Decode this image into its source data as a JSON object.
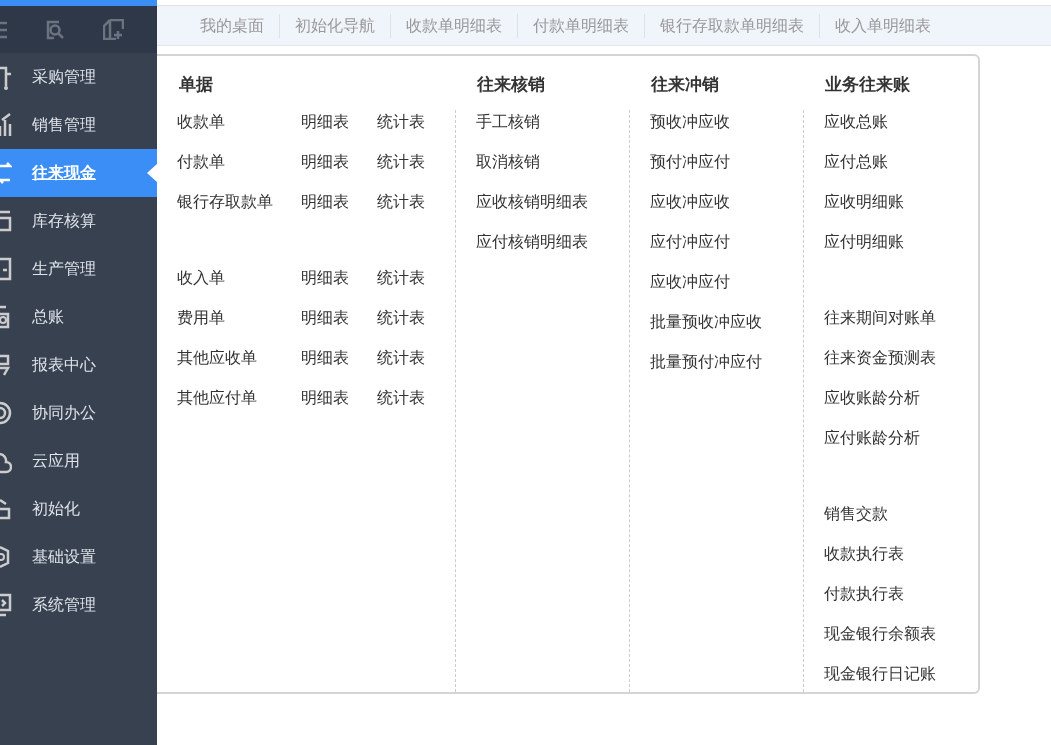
{
  "sidebar": {
    "items": [
      {
        "label": "采购管理",
        "selected": false
      },
      {
        "label": "销售管理",
        "selected": false
      },
      {
        "label": "往来现金",
        "selected": true
      },
      {
        "label": "库存核算",
        "selected": false
      },
      {
        "label": "生产管理",
        "selected": false
      },
      {
        "label": "总账",
        "selected": false
      },
      {
        "label": "报表中心",
        "selected": false
      },
      {
        "label": "协同办公",
        "selected": false
      },
      {
        "label": "云应用",
        "selected": false
      },
      {
        "label": "初始化",
        "selected": false
      },
      {
        "label": "基础设置",
        "selected": false
      },
      {
        "label": "系统管理",
        "selected": false
      }
    ]
  },
  "tabs": [
    "我的桌面",
    "初始化导航",
    "收款单明细表",
    "付款单明细表",
    "银行存取款单明细表",
    "收入单明细表"
  ],
  "menu": {
    "documents": {
      "heading": "单据",
      "groups": [
        [
          {
            "name": "收款单",
            "detail": "明细表",
            "stats": "统计表"
          },
          {
            "name": "付款单",
            "detail": "明细表",
            "stats": "统计表"
          },
          {
            "name": "银行存取款单",
            "detail": "明细表",
            "stats": "统计表"
          }
        ],
        [
          {
            "name": "收入单",
            "detail": "明细表",
            "stats": "统计表"
          },
          {
            "name": "费用单",
            "detail": "明细表",
            "stats": "统计表"
          },
          {
            "name": "其他应收单",
            "detail": "明细表",
            "stats": "统计表"
          },
          {
            "name": "其他应付单",
            "detail": "明细表",
            "stats": "统计表"
          }
        ]
      ]
    },
    "columns": [
      {
        "heading": "往来核销",
        "groups": [
          [
            "手工核销",
            "取消核销",
            "应收核销明细表",
            "应付核销明细表"
          ]
        ]
      },
      {
        "heading": "往来冲销",
        "groups": [
          [
            "预收冲应收",
            "预付冲应付",
            "应收冲应收",
            "应付冲应付",
            "应收冲应付",
            "批量预收冲应收",
            "批量预付冲应付"
          ]
        ]
      },
      {
        "heading": "业务往来账",
        "groups": [
          [
            "应收总账",
            "应付总账",
            "应收明细账",
            "应付明细账"
          ],
          [
            "往来期间对账单",
            "往来资金预测表",
            "应收账龄分析",
            "应付账龄分析"
          ],
          [
            "销售交款",
            "收款执行表",
            "付款执行表",
            "现金银行余额表",
            "现金银行日记账"
          ]
        ]
      }
    ]
  }
}
